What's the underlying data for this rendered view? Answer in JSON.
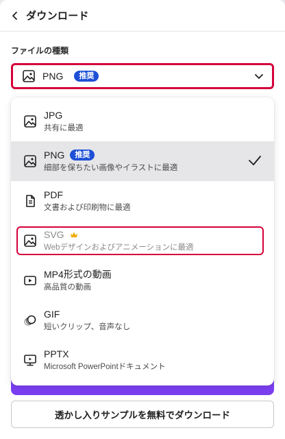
{
  "header": {
    "title": "ダウンロード"
  },
  "file_type": {
    "label": "ファイルの種類",
    "selected_value": "PNG",
    "selected_badge": "推奨"
  },
  "options": [
    {
      "name": "JPG",
      "desc": "共有に最適",
      "icon": "image-icon"
    },
    {
      "name": "PNG",
      "badge": "推奨",
      "desc": "細部を保ちたい画像やイラストに最適",
      "icon": "image-icon",
      "selected": true
    },
    {
      "name": "PDF",
      "desc": "文書および印刷物に最適",
      "icon": "document-icon"
    },
    {
      "name": "SVG",
      "desc": "Webデザインおよびアニメーションに最適",
      "icon": "image-icon",
      "premium": true
    },
    {
      "name": "MP4形式の動画",
      "desc": "高品質の動画",
      "icon": "video-icon"
    },
    {
      "name": "GIF",
      "desc": "短いクリップ、音声なし",
      "icon": "gif-icon"
    },
    {
      "name": "PPTX",
      "desc": "Microsoft PowerPointドキュメント",
      "icon": "presentation-icon"
    }
  ],
  "bottom_button": {
    "label": "透かし入りサンプルを無料でダウンロード"
  },
  "colors": {
    "accent_red": "#d4003a",
    "badge_blue": "#1e4fd6",
    "purple": "#7b3ff2",
    "crown_gold": "#f2a900"
  }
}
